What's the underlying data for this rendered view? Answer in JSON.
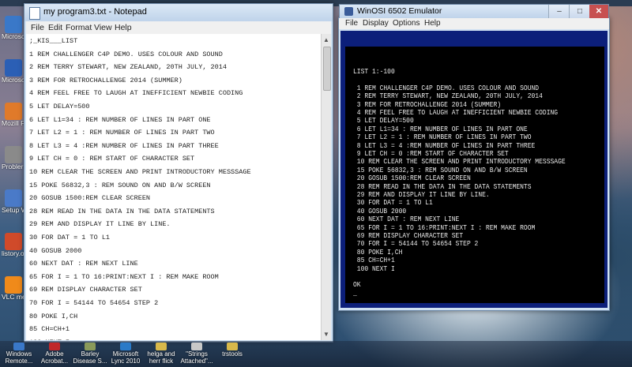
{
  "desktop": {
    "icons": [
      {
        "label": "Microsc Outlo",
        "icon": "outlook-icon",
        "color": "#3a78c8"
      },
      {
        "label": "Microsc Word",
        "icon": "word-icon",
        "color": "#2b5fb5"
      },
      {
        "label": "Mozill Firefo",
        "icon": "firefox-icon",
        "color": "#e07a2a"
      },
      {
        "label": "Probler Steps R",
        "icon": "problem-steps-icon",
        "color": "#8a8a8a"
      },
      {
        "label": "Setup Windo",
        "icon": "setup-icon",
        "color": "#4a7ac8"
      },
      {
        "label": "listory.ol Amiga (Ki",
        "icon": "amiga-icon",
        "color": "#d04a2a"
      },
      {
        "label": "VLC me player",
        "icon": "vlc-icon",
        "color": "#f08a1a"
      }
    ]
  },
  "notepad": {
    "title": "my program3.txt - Notepad",
    "menu": [
      "File",
      "Edit",
      "Format",
      "View",
      "Help"
    ],
    "lines": [
      ";_KIS___LIST",
      "1 REM CHALLENGER C4P DEMO. USES COLOUR AND SOUND",
      "2 REM TERRY STEWART, NEW ZEALAND, 20TH JULY, 2014",
      "3 REM FOR RETROCHALLENGE 2014 (SUMMER)",
      "4 REM FEEL FREE TO LAUGH AT INEFFICIENT NEWBIE CODING",
      "5 LET DELAY=500",
      "6 LET L1=34 : REM NUMBER OF LINES IN PART ONE",
      "7 LET L2 = 1 : REM NUMBER OF LINES IN PART TWO",
      "8 LET L3 = 4 :REM NUMBER OF LINES IN PART THREE",
      "9 LET CH = 0 : REM START OF CHARACTER SET",
      "10 REM CLEAR THE SCREEN AND PRINT INTRODUCTORY MESSSAGE",
      "15 POKE 56832,3 : REM SOUND ON AND B/W SCREEN",
      "20 GOSUB 1500:REM CLEAR SCREEN",
      "28 REM READ IN THE DATA IN THE DATA STATEMENTS",
      "29 REM AND DISPLAY IT LINE BY LINE.",
      "30 FOR DAT = 1 TO L1",
      "40 GOSUB 2000",
      "60 NEXT DAT : REM NEXT LINE",
      "65 FOR I = 1 TO 16:PRINT:NEXT I : REM MAKE ROOM",
      "69 REM DISPLAY CHARACTER SET",
      "70 FOR I = 54144 TO 54654 STEP 2",
      "80 POKE I,CH",
      "85 CH=CH+1",
      "100 NEXT I"
    ]
  },
  "emulator": {
    "title": "WinOSI 6502 Emulator",
    "menu": [
      "File",
      "Display",
      "Options",
      "Help"
    ],
    "lines": [
      "LIST 1:-100",
      "",
      " 1 REM CHALLENGER C4P DEMO. USES COLOUR AND SOUND",
      " 2 REM TERRY STEWART, NEW ZEALAND, 20TH JULY, 2014",
      " 3 REM FOR RETROCHALLENGE 2014 (SUMMER)",
      " 4 REM FEEL FREE TO LAUGH AT INEFFICIENT NEWBIE CODING",
      " 5 LET DELAY=500",
      " 6 LET L1=34 : REM NUMBER OF LINES IN PART ONE",
      " 7 LET L2 = 1 : REM NUMBER OF LINES IN PART TWO",
      " 8 LET L3 = 4 :REM NUMBER OF LINES IN PART THREE",
      " 9 LET CH = 0 :REM START OF CHARACTER SET",
      " 10 REM CLEAR THE SCREEN AND PRINT INTRODUCTORY MESSSAGE",
      " 15 POKE 56832,3 : REM SOUND ON AND B/W SCREEN",
      " 20 GOSUB 1500:REM CLEAR SCREEN",
      " 28 REM READ IN THE DATA IN THE DATA STATEMENTS",
      " 29 REM AND DISPLAY IT LINE BY LINE.",
      " 30 FOR DAT = 1 TO L1",
      " 40 GOSUB 2000",
      " 60 NEXT DAT : REM NEXT LINE",
      " 65 FOR I = 1 TO 16:PRINT:NEXT I : REM MAKE ROOM",
      " 69 REM DISPLAY CHARACTER SET",
      " 70 FOR I = 54144 TO 54654 STEP 2",
      " 80 POKE I,CH",
      " 85 CH=CH+1",
      " 100 NEXT I",
      "",
      "OK",
      "_"
    ]
  },
  "taskbar": {
    "items": [
      {
        "label": "Windows Remote...",
        "icon": "remote-desktop-icon",
        "color": "#3a78c8"
      },
      {
        "label": "Adobe Acrobat...",
        "icon": "acrobat-icon",
        "color": "#c0282a"
      },
      {
        "label": "Barley Disease S...",
        "icon": "document-icon",
        "color": "#8a9a5a"
      },
      {
        "label": "Microsoft Lync 2010",
        "icon": "lync-icon",
        "color": "#2a7ac8"
      },
      {
        "label": "helga and herr flick",
        "icon": "folder-icon",
        "color": "#d8b84a"
      },
      {
        "label": "\"Strings Attached\"...",
        "icon": "document-icon",
        "color": "#c8c8c8"
      },
      {
        "label": "trstools",
        "icon": "folder-icon",
        "color": "#d8b84a"
      }
    ]
  }
}
